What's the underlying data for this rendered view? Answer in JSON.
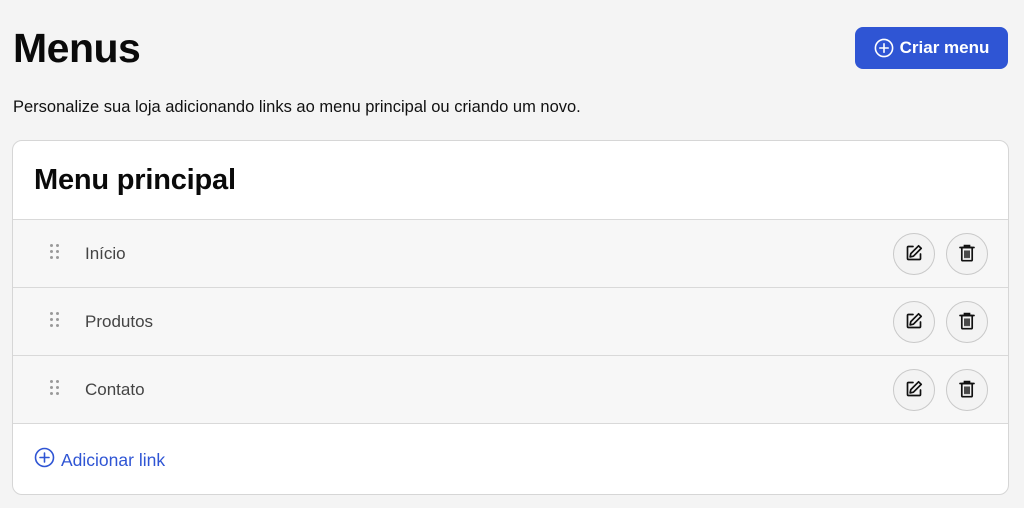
{
  "header": {
    "title": "Menus",
    "create_button_label": "Criar menu",
    "create_button_icon": "plus-circle-icon",
    "subtitle": "Personalize sua loja adicionando links ao menu principal ou criando um novo."
  },
  "card": {
    "title": "Menu principal",
    "items": [
      {
        "label": "Início"
      },
      {
        "label": "Produtos"
      },
      {
        "label": "Contato"
      }
    ],
    "add_link_label": "Adicionar link",
    "add_link_icon": "plus-circle-icon"
  },
  "colors": {
    "accent": "#2f55d4",
    "background": "#f4f4f4",
    "card": "#ffffff",
    "row_background": "#f7f7f7",
    "border": "#d9d9d9"
  },
  "icons": {
    "drag": "drag-handle-icon",
    "edit": "edit-icon",
    "delete": "trash-icon"
  }
}
